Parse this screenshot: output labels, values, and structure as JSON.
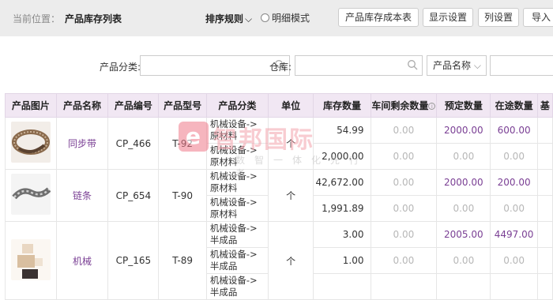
{
  "header": {
    "location_label": "当前位置：",
    "location_value": "产品库存列表",
    "sort_label": "排序规则",
    "detail_mode_label": "明细模式",
    "buttons": [
      "产品库存成本表",
      "显示设置",
      "列设置",
      "导入"
    ]
  },
  "filters": {
    "category_label": "产品分类:",
    "warehouse_label": "仓库:",
    "name_select": "产品名称"
  },
  "table": {
    "columns": [
      "产品图片",
      "产品名称",
      "产品编号",
      "产品型号",
      "产品分类",
      "单位",
      "库存数量",
      "车间剩余数量",
      "预定数量",
      "在途数量",
      "基"
    ],
    "rows": [
      {
        "name": "同步带",
        "code": "CP_466",
        "model": "T-92",
        "unit": "个",
        "sub": [
          {
            "category": "机械设备->原材料",
            "stock": "54.99",
            "workshop": "0.00",
            "reserved": "2000.00",
            "transit": "600.00"
          },
          {
            "category": "机械设备->原材料",
            "stock": "2,000.00",
            "workshop": "0.00",
            "reserved": "0.00",
            "transit": "0.00"
          }
        ]
      },
      {
        "name": "链条",
        "code": "CP_654",
        "model": "T-90",
        "unit": "个",
        "sub": [
          {
            "category": "机械设备->原材料",
            "stock": "42,672.00",
            "workshop": "0.00",
            "reserved": "2000.00",
            "transit": "200.00"
          },
          {
            "category": "机械设备->原材料",
            "stock": "1,991.89",
            "workshop": "0.00",
            "reserved": "0.00",
            "transit": "0.00"
          }
        ]
      },
      {
        "name": "机械",
        "code": "CP_165",
        "model": "T-89",
        "unit": "个",
        "sub": [
          {
            "category": "机械设备->半成品",
            "stock": "3.00",
            "workshop": "0.00",
            "reserved": "2005.00",
            "transit": "4497.00"
          },
          {
            "category": "机械设备->半成品",
            "stock": "1.00",
            "workshop": "0.00",
            "reserved": "0.00",
            "transit": "0.00"
          },
          {
            "category": "机械设备->半成品",
            "stock": "",
            "workshop": "",
            "reserved": "",
            "transit": ""
          }
        ]
      }
    ]
  },
  "watermark": {
    "logo_letter": "e",
    "title": "智邦国际",
    "subtitle": "数智一体化先行者"
  },
  "colors": {
    "header_bg": "#ececec",
    "table_header_bg": "#f1e7f3",
    "accent": "#7a3f94"
  }
}
